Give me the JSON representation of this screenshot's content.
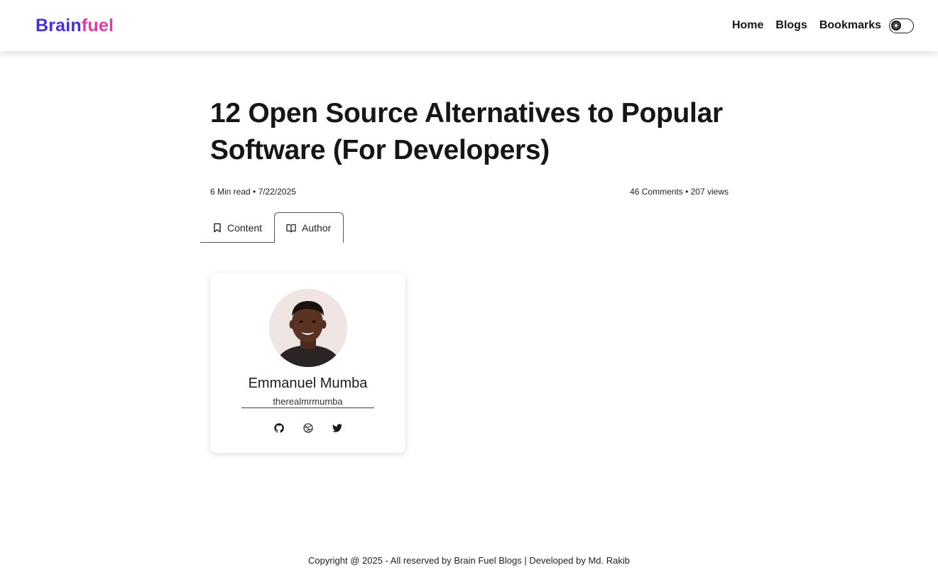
{
  "brand": {
    "part1": "Brain",
    "part2": "fuel"
  },
  "nav": {
    "links": [
      "Home",
      "Blogs",
      "Bookmarks"
    ]
  },
  "article": {
    "title": "12 Open Source Alternatives to Popular Software (For Developers)",
    "meta_left": "6 Min read • 7/22/2025",
    "meta_right": "46 Comments • 207 views"
  },
  "tabs": [
    {
      "label": "Content",
      "icon": "bookmark-icon",
      "active": false
    },
    {
      "label": "Author",
      "icon": "open-book-icon",
      "active": true
    }
  ],
  "author": {
    "name": "Emmanuel Mumba",
    "handle": "therealmrmumba",
    "socials": [
      "github-icon",
      "dribbble-icon",
      "twitter-icon"
    ]
  },
  "footer": {
    "text": "Copyright @ 2025 - All reserved by Brain Fuel Blogs | Developed by Md. Rakib"
  },
  "colors": {
    "brand_primary": "#4b2fd6",
    "brand_secondary": "#e33aa6",
    "text": "#161616"
  }
}
